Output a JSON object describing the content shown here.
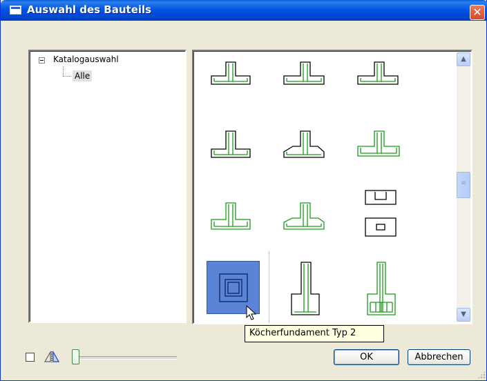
{
  "window": {
    "title": "Auswahl des Bauteils",
    "close_icon": "close-icon",
    "accent": "#0055e5"
  },
  "tree": {
    "root_label": "Katalogauswahl",
    "child_label": "Alle"
  },
  "gallery": {
    "item_count_visible": 12,
    "selected_item_tooltip": "Köcherfundament Typ 2",
    "stroke_green": "#1a9a1a",
    "selection_color": "#5b84d6"
  },
  "scrollbar": {
    "up_icon": "chevron-up-icon",
    "down_icon": "chevron-down-icon"
  },
  "footer": {
    "ok_label": "OK",
    "cancel_label": "Abbrechen",
    "checkbox_icon": "square-icon",
    "mirror_icon": "mirror-icon"
  }
}
